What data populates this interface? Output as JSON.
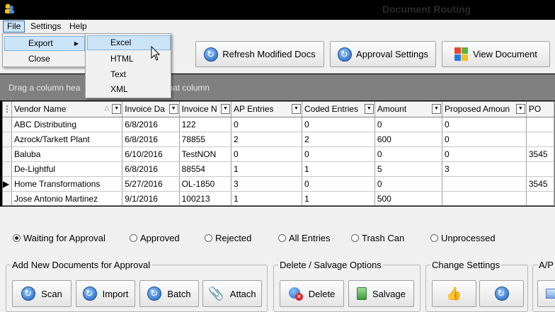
{
  "window": {
    "title": "Document Routing"
  },
  "menu": {
    "file": "File",
    "settings": "Settings",
    "help": "Help",
    "file_items": [
      "Export",
      "Close"
    ],
    "export_items": [
      "Excel",
      "HTML",
      "Text",
      "XML"
    ]
  },
  "toolbar": {
    "refresh_label": "Refresh Modified Docs",
    "approval_label": "Approval Settings",
    "view_label": "View Document"
  },
  "groupbar": {
    "text_left": "Drag a column hea",
    "text_right": "hat column"
  },
  "grid": {
    "columns": [
      "Vendor Name",
      "Invoice Da",
      "Invoice N",
      "AP Entries",
      "Coded Entries",
      "Amount",
      "Proposed Amoun",
      "PO"
    ],
    "rows": [
      [
        "ABC Distributing",
        "6/8/2016",
        "122",
        "0",
        "0",
        "0",
        "0",
        ""
      ],
      [
        "Azrock/Tarkett Plant",
        "6/8/2016",
        "78855",
        "2",
        "2",
        "600",
        "0",
        ""
      ],
      [
        "Baluba",
        "6/10/2016",
        "TestNON",
        "0",
        "0",
        "0",
        "0",
        "3545"
      ],
      [
        "De-Lightful",
        "6/8/2016",
        "88554",
        "1",
        "1",
        "5",
        "3",
        ""
      ],
      [
        "Home Transformations",
        "5/27/2016",
        "OL-1850",
        "3",
        "0",
        "0",
        "",
        "3545"
      ],
      [
        "Jose Antonio Martinez",
        "9/1/2016",
        "100213",
        "1",
        "1",
        "500",
        "",
        ""
      ]
    ],
    "current_row": 4
  },
  "filters": {
    "options": [
      "Waiting for Approval",
      "Approved",
      "Rejected",
      "All Entries",
      "Trash Can",
      "Unprocessed"
    ],
    "selected": "Waiting for Approval"
  },
  "groups": {
    "add_title": "Add New Documents for Approval",
    "add_buttons": [
      "Scan",
      "Import",
      "Batch",
      "Attach"
    ],
    "delete_title": "Delete / Salvage Options",
    "delete_buttons": [
      "Delete",
      "Salvage"
    ],
    "change_title": "Change Settings",
    "ap_title": "A/P"
  },
  "colors": {
    "highlight": "#cce4f7",
    "group_bar": "#808080",
    "accent_blue": "#1e5fb8"
  }
}
